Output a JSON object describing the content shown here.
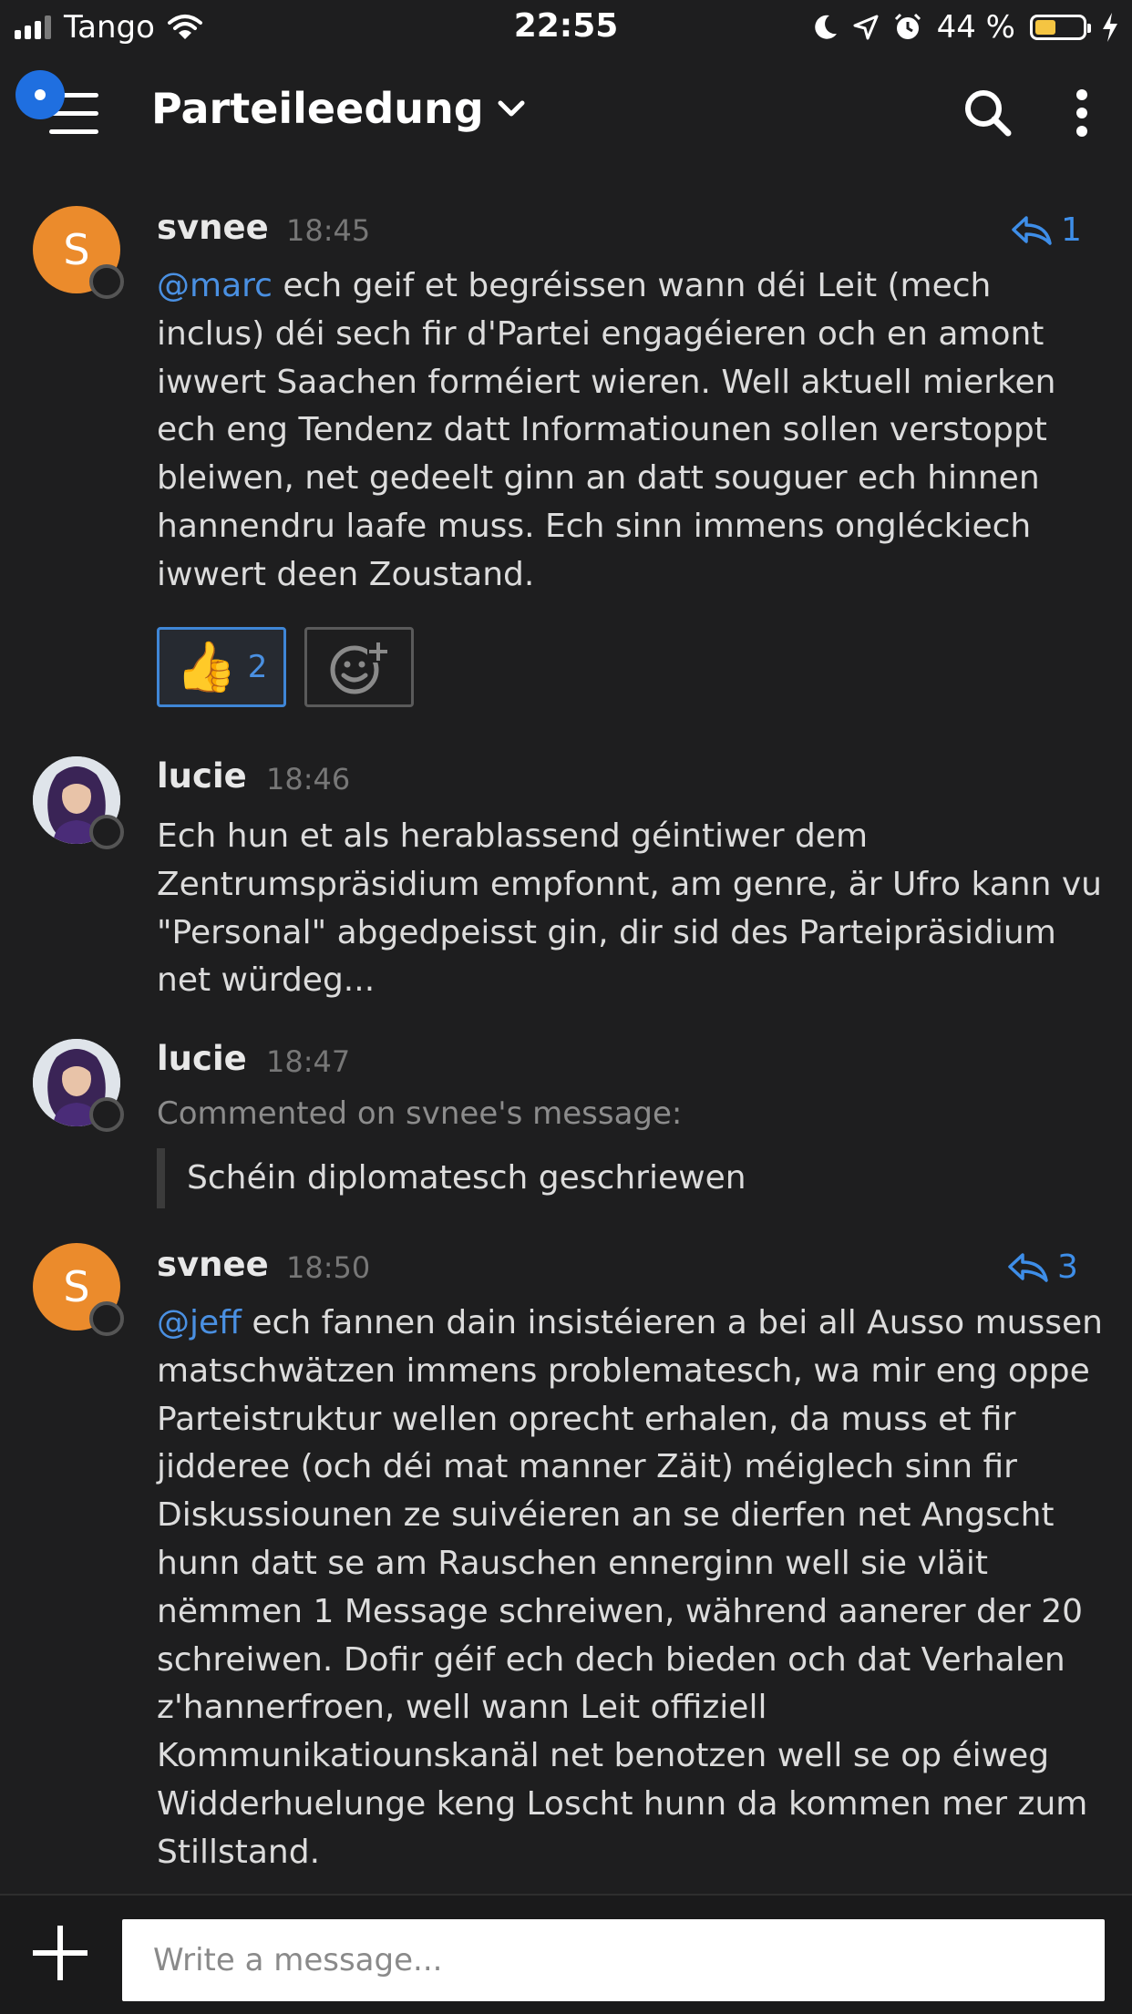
{
  "status_bar": {
    "carrier": "Tango",
    "time": "22:55",
    "battery_percent": "44 %",
    "battery_level": 0.44,
    "icons": [
      "signal-icon",
      "wifi-icon",
      "moon-icon",
      "location-icon",
      "alarm-icon",
      "battery-icon",
      "charging-icon"
    ]
  },
  "header": {
    "room_name": "Parteileedung",
    "icons": [
      "menu-icon",
      "chevron-down-icon",
      "search-icon",
      "more-vertical-icon"
    ],
    "accent": "#1f6fe0"
  },
  "messages": [
    {
      "avatar_letter": "S",
      "avatar_color": "#eb8b2c",
      "user": "svnee",
      "time": "18:45",
      "reply_count": "1",
      "mention": "@marc",
      "text": " ech geif et begréissen wann déi Leit (mech inclus) déi sech fir d'Partei engagéieren och en amont iwwert Saachen forméiert wieren. Well aktuell mierken ech eng Tendenz datt Informatiounen sollen verstoppt bleiwen, net gedeelt ginn an datt souguer ech hinnen hannendru laafe muss. Ech sinn immens ongléckiech iwwert deen Zoustand.",
      "reaction": {
        "emoji": "👍",
        "count": "2"
      }
    },
    {
      "avatar": "photo",
      "user": "lucie",
      "time": "18:46",
      "text": "Ech hun et als herablassend géintiwer dem Zentrumspräsidium empfonnt, am  genre, är Ufro kann vu \"Personal\" abgedpeisst gin, dir sid des Parteipräsidium net würdeg..."
    },
    {
      "avatar": "photo",
      "user": "lucie",
      "time": "18:47",
      "comment_meta": "Commented on svnee's message:",
      "quote": "Schéin diplomatesch geschriewen"
    },
    {
      "avatar_letter": "S",
      "avatar_color": "#eb8b2c",
      "user": "svnee",
      "time": "18:50",
      "reply_count": "3",
      "mention": "@jeff",
      "text": " ech fannen dain insistéieren a bei all Ausso mussen matschwätzen immens problematesch, wa mir eng oppe Parteistruktur wellen oprecht erhalen, da muss et fir jidderee (och déi mat manner Zäit) méiglech sinn fir Diskussiounen ze suivéieren an se dierfen net Angscht hunn datt se am Rauschen ennerginn well sie vläit nëmmen 1 Message schreiwen, während aanerer der 20 schreiwen. Dofir géif ech dech bieden och dat Verhalen z'hannerfroen, well wann Leit offiziell Kommunikatiounskanäl net benotzen well se op éiweg Widderhuelunge keng Loscht hunn da kommen mer zum Stillstand."
    }
  ],
  "composer": {
    "placeholder": "Write a message...",
    "icons": [
      "plus-icon"
    ]
  }
}
